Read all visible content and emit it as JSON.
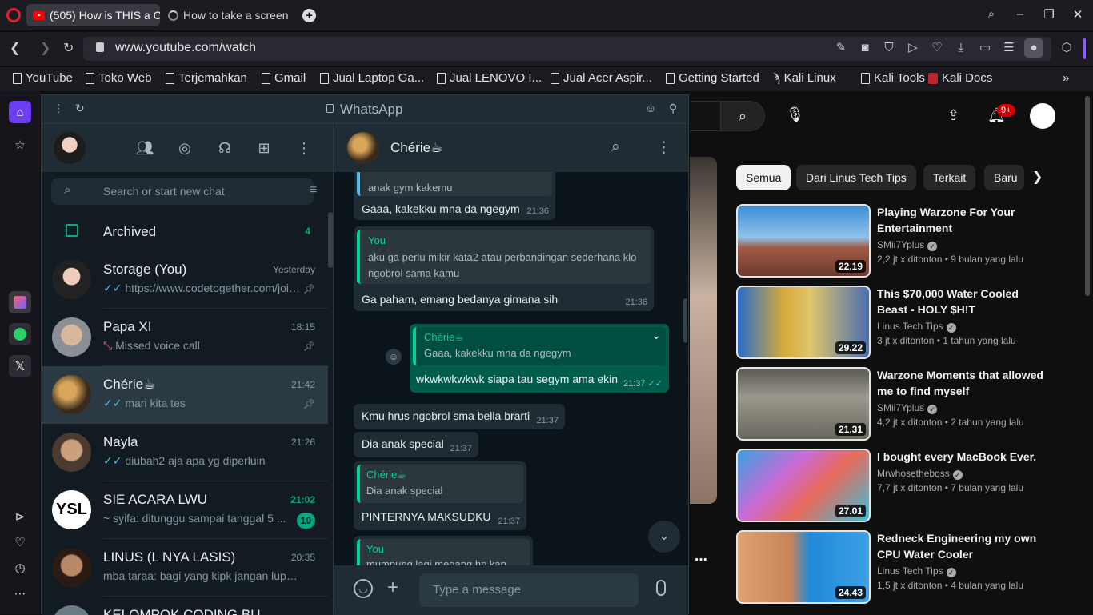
{
  "browser": {
    "tabs": [
      {
        "title": "(505) How is THIS a C"
      },
      {
        "title": "How to take a screen"
      }
    ],
    "url": "www.youtube.com/watch",
    "bookmarks": [
      "YouTube",
      "Toko Web",
      "Terjemahkan",
      "Gmail",
      "Jual Laptop Ga...",
      "Jual LENOVO I...",
      "Jual Acer Aspir...",
      "Getting Started",
      "Kali Linux",
      "Kali Tools",
      "Kali Docs"
    ],
    "more_bookmarks": "»"
  },
  "whatsapp": {
    "window_title": "WhatsApp",
    "search_placeholder": "Search or start new chat",
    "archived": {
      "label": "Archived",
      "count": "4"
    },
    "chats": [
      {
        "name": "Storage (You)",
        "time": "Yesterday",
        "msg": "https://www.codetogether.com/join..."
      },
      {
        "name": "Papa XI",
        "time": "18:15",
        "msg": "Missed voice call"
      },
      {
        "name": "Chérie☕",
        "time": "21:42",
        "msg": "mari kita tes"
      },
      {
        "name": "Nayla",
        "time": "21:26",
        "msg": "diubah2 aja apa yg diperluin"
      },
      {
        "name": "SIE ACARA LWU",
        "time": "21:02",
        "msg": "~ syifa: ditunggu sampai tanggal 5 ...",
        "unread": "10"
      },
      {
        "name": "LINUS (L NYA LASIS)",
        "time": "20:35",
        "msg": "mba taraa: bagi yang kipk jangan lupa ..."
      },
      {
        "name": "KELOMPOK CODING BU",
        "time": "",
        "msg": ""
      }
    ],
    "conversation": {
      "contact": "Chérie☕",
      "messages": [
        {
          "quote_text": "anak gym kakemu",
          "text": "Gaaa, kakekku mna da ngegym",
          "time": "21:36"
        },
        {
          "quote_name": "You",
          "quote_text": "aku ga perlu mikir kata2 atau perbandingan sederhana klo ngobrol sama kamu",
          "text": "Ga paham, emang bedanya gimana sih",
          "time": "21:36"
        },
        {
          "quote_name": "Chérie☕",
          "quote_text": "Gaaa, kakekku mna da ngegym",
          "text": "wkwkwkwkwk siapa tau segym ama ekin",
          "time": "21:37"
        },
        {
          "text": "Kmu hrus ngobrol sma bella brarti",
          "time": "21:37"
        },
        {
          "text": "Dia anak special",
          "time": "21:37"
        },
        {
          "quote_name": "Chérie☕",
          "quote_text": "Dia anak special",
          "text": "PINTERNYA MAKSUDKU",
          "time": "21:37"
        },
        {
          "quote_name": "You",
          "quote_text": "mumpung lagi megang hp kan tuh"
        }
      ],
      "input_placeholder": "Type a message"
    }
  },
  "youtube": {
    "chips": [
      "Semua",
      "Dari Linus Tech Tips",
      "Terkait",
      "Baru"
    ],
    "notif_count": "9+",
    "videos": [
      {
        "title": "Playing Warzone For Your Entertainment",
        "channel": "SMii7Yplus",
        "views": "2,2 jt x ditonton",
        "age": "9 bulan yang lalu",
        "duration": "22.19"
      },
      {
        "title": "This $70,000 Water Cooled Beast - HOLY $H!T",
        "channel": "Linus Tech Tips",
        "views": "3 jt x ditonton",
        "age": "1 tahun yang lalu",
        "duration": "29.22"
      },
      {
        "title": "Warzone Moments that allowed me to find myself",
        "channel": "SMii7Yplus",
        "views": "4,2 jt x ditonton",
        "age": "2 tahun yang lalu",
        "duration": "21.31"
      },
      {
        "title": "I bought every MacBook Ever.",
        "channel": "Mrwhosetheboss",
        "views": "7,7 jt x ditonton",
        "age": "7 bulan yang lalu",
        "duration": "27.01"
      },
      {
        "title": "Redneck Engineering my own CPU Water Cooler",
        "channel": "Linus Tech Tips",
        "views": "1,5 jt x ditonton",
        "age": "4 bulan yang lalu",
        "duration": "24.43"
      }
    ],
    "sep": "•"
  }
}
